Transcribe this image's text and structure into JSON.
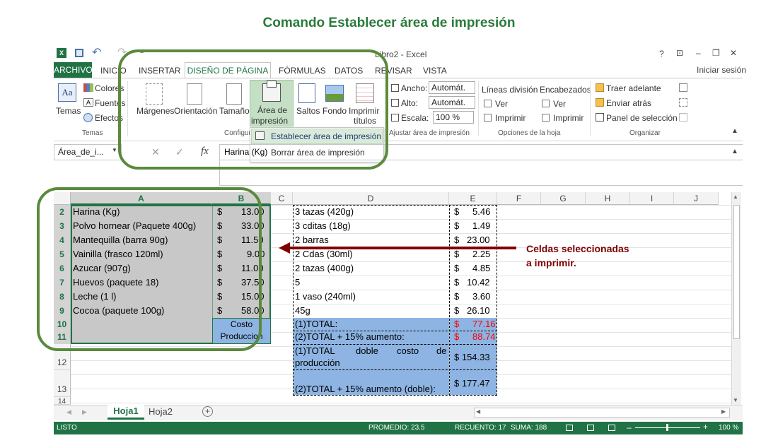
{
  "caption": "Comando Establecer área de impresión",
  "window": {
    "title": "Libro2 - Excel",
    "controls": {
      "help": "?",
      "restore_ribbon": "⊡",
      "minimize": "–",
      "restore": "❐",
      "close": "✕"
    },
    "signin": "Iniciar sesión",
    "undo": "↶",
    "redo": "↷",
    "customize": "="
  },
  "tabs": {
    "archivo": "ARCHIVO",
    "inicio": "INICIO",
    "insertar": "INSERTAR",
    "diseno": "DISEÑO DE PÁGINA",
    "formulas": "FÓRMULAS",
    "datos": "DATOS",
    "revisar": "REVISAR",
    "vista": "VISTA"
  },
  "ribbon": {
    "temas": {
      "temas_btn": "Temas",
      "colores": "Colores",
      "fuentes": "Fuentes",
      "efectos": "Efectos",
      "group": "Temas"
    },
    "config": {
      "margenes": "Márgenes",
      "orientacion": "Orientación",
      "tamano": "Tamaño",
      "area_line1": "Área de",
      "area_line2": "impresión",
      "saltos": "Saltos",
      "fondo": "Fondo",
      "imprimir_line1": "Imprimir",
      "imprimir_line2": "títulos",
      "group": "Configurar página"
    },
    "ajustar": {
      "ancho_label": "Ancho:",
      "ancho_value": "Automát.",
      "alto_label": "Alto:",
      "alto_value": "Automát.",
      "escala_label": "Escala:",
      "escala_value": "100 %",
      "group": "Ajustar área de impresión"
    },
    "opciones": {
      "lineas": "Líneas división",
      "encabezados": "Encabezados",
      "ver": "Ver",
      "imprimir": "Imprimir",
      "group": "Opciones de la hoja"
    },
    "organizar": {
      "traer": "Traer adelante",
      "enviar": "Enviar atrás",
      "panel": "Panel de selección",
      "group": "Organizar"
    }
  },
  "dropdown": {
    "establecer": "Establecer área de impresión",
    "borrar": "Borrar área de impresión"
  },
  "formula_bar": {
    "namebox": "Área_de_i...",
    "cancel": "✕",
    "enter": "✓",
    "fx": "fx",
    "content": "Harina (Kg)"
  },
  "columns": [
    "A",
    "B",
    "C",
    "D",
    "E",
    "F",
    "G",
    "H",
    "I",
    "J"
  ],
  "rows": [
    "2",
    "3",
    "4",
    "5",
    "6",
    "7",
    "8",
    "9",
    "10",
    "11",
    "12",
    "13",
    "14"
  ],
  "col_a": [
    "Harina (Kg)",
    "Polvo hornear (Paquete 400g)",
    "Mantequilla (barra 90g)",
    "Vainilla (frasco 120ml)",
    "Azucar (907g)",
    "Huevos (paquete 18)",
    "Leche (1 l)",
    "Cocoa (paquete 100g)"
  ],
  "col_b": [
    "13.00",
    "33.00",
    "11.50",
    "9.00",
    "11.00",
    "37.50",
    "15.00",
    "58.00"
  ],
  "currency": "$",
  "costo": "Costo Produccion",
  "col_d": [
    "3 tazas (420g)",
    "3 cditas (18g)",
    "2 barras",
    "2 Cdas (30ml)",
    "2 tazas (400g)",
    "5",
    "1 vaso (240ml)",
    "45g"
  ],
  "col_e": [
    "5.46",
    "1.49",
    "23.00",
    "2.25",
    "4.85",
    "10.42",
    "3.60",
    "26.10"
  ],
  "totals": {
    "t1_label": "(1)TOTAL:",
    "t1_value": "77.16",
    "t2_label": "(2)TOTAL + 15% aumento:",
    "t2_value": "88.74",
    "t3_label_a": "(1)TOTAL",
    "t3_label_b": "doble",
    "t3_label_c": "costo",
    "t3_label_d": "de",
    "t3_label_e": "producción",
    "t3_value": "$ 154.33",
    "t4_label": "(2)TOTAL + 15% aumento (doble):",
    "t4_value": "$ 177.47"
  },
  "annotation": {
    "line1": "Celdas seleccionadas",
    "line2": "a imprimir."
  },
  "sheets": {
    "active": "Hoja1",
    "other": "Hoja2",
    "add": "+"
  },
  "status": {
    "ready": "LISTO",
    "promedio": "PROMEDIO: 23.5",
    "recuento": "RECUENTO: 17",
    "suma": "SUMA: 188",
    "zoom": "100 %"
  },
  "colors": {
    "excel_green": "#217346",
    "highlight_green": "#5a8a3c",
    "arrow_red": "#7f0000",
    "sel_blue": "#8db4e2"
  }
}
